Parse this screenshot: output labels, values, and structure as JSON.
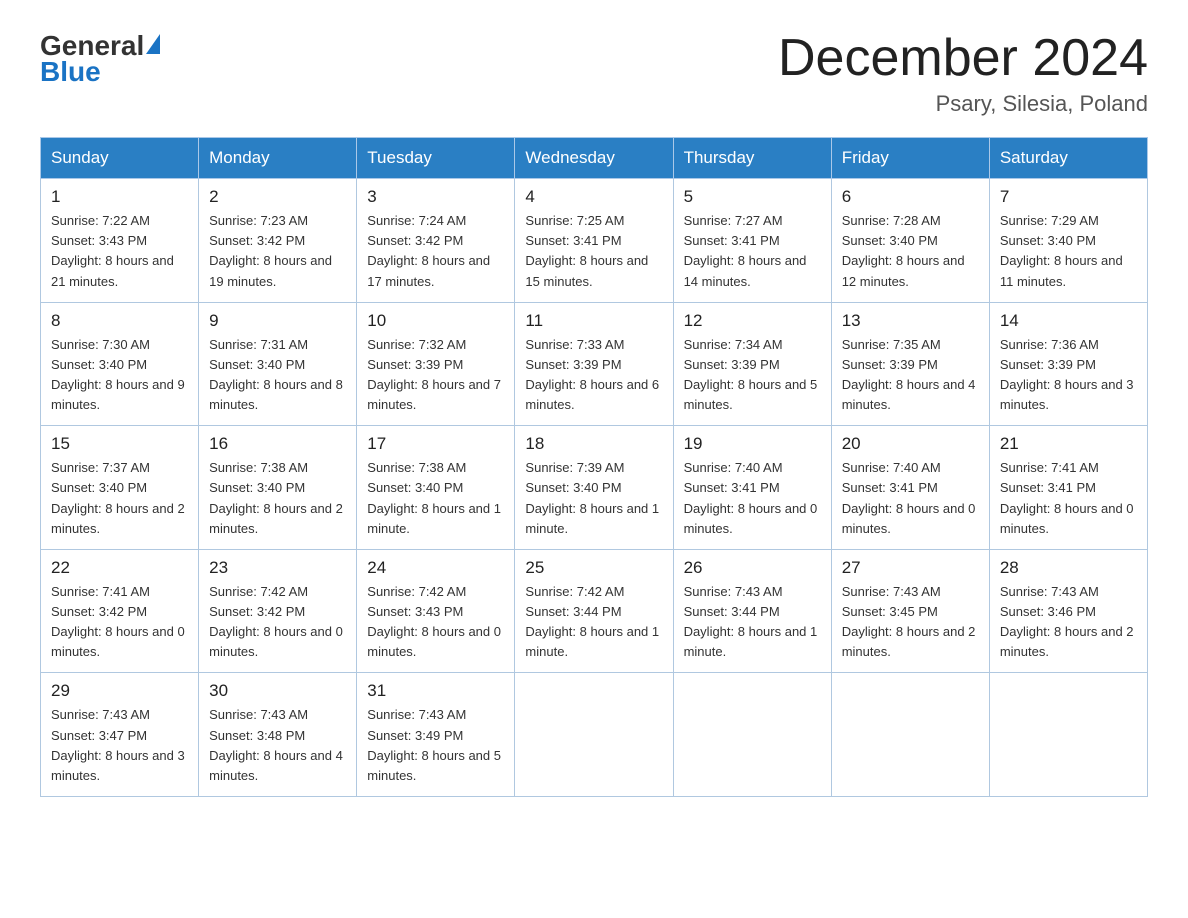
{
  "header": {
    "logo_general": "General",
    "logo_blue": "Blue",
    "main_title": "December 2024",
    "subtitle": "Psary, Silesia, Poland"
  },
  "days_of_week": [
    "Sunday",
    "Monday",
    "Tuesday",
    "Wednesday",
    "Thursday",
    "Friday",
    "Saturday"
  ],
  "weeks": [
    [
      {
        "day": "1",
        "sunrise": "7:22 AM",
        "sunset": "3:43 PM",
        "daylight": "8 hours and 21 minutes."
      },
      {
        "day": "2",
        "sunrise": "7:23 AM",
        "sunset": "3:42 PM",
        "daylight": "8 hours and 19 minutes."
      },
      {
        "day": "3",
        "sunrise": "7:24 AM",
        "sunset": "3:42 PM",
        "daylight": "8 hours and 17 minutes."
      },
      {
        "day": "4",
        "sunrise": "7:25 AM",
        "sunset": "3:41 PM",
        "daylight": "8 hours and 15 minutes."
      },
      {
        "day": "5",
        "sunrise": "7:27 AM",
        "sunset": "3:41 PM",
        "daylight": "8 hours and 14 minutes."
      },
      {
        "day": "6",
        "sunrise": "7:28 AM",
        "sunset": "3:40 PM",
        "daylight": "8 hours and 12 minutes."
      },
      {
        "day": "7",
        "sunrise": "7:29 AM",
        "sunset": "3:40 PM",
        "daylight": "8 hours and 11 minutes."
      }
    ],
    [
      {
        "day": "8",
        "sunrise": "7:30 AM",
        "sunset": "3:40 PM",
        "daylight": "8 hours and 9 minutes."
      },
      {
        "day": "9",
        "sunrise": "7:31 AM",
        "sunset": "3:40 PM",
        "daylight": "8 hours and 8 minutes."
      },
      {
        "day": "10",
        "sunrise": "7:32 AM",
        "sunset": "3:39 PM",
        "daylight": "8 hours and 7 minutes."
      },
      {
        "day": "11",
        "sunrise": "7:33 AM",
        "sunset": "3:39 PM",
        "daylight": "8 hours and 6 minutes."
      },
      {
        "day": "12",
        "sunrise": "7:34 AM",
        "sunset": "3:39 PM",
        "daylight": "8 hours and 5 minutes."
      },
      {
        "day": "13",
        "sunrise": "7:35 AM",
        "sunset": "3:39 PM",
        "daylight": "8 hours and 4 minutes."
      },
      {
        "day": "14",
        "sunrise": "7:36 AM",
        "sunset": "3:39 PM",
        "daylight": "8 hours and 3 minutes."
      }
    ],
    [
      {
        "day": "15",
        "sunrise": "7:37 AM",
        "sunset": "3:40 PM",
        "daylight": "8 hours and 2 minutes."
      },
      {
        "day": "16",
        "sunrise": "7:38 AM",
        "sunset": "3:40 PM",
        "daylight": "8 hours and 2 minutes."
      },
      {
        "day": "17",
        "sunrise": "7:38 AM",
        "sunset": "3:40 PM",
        "daylight": "8 hours and 1 minute."
      },
      {
        "day": "18",
        "sunrise": "7:39 AM",
        "sunset": "3:40 PM",
        "daylight": "8 hours and 1 minute."
      },
      {
        "day": "19",
        "sunrise": "7:40 AM",
        "sunset": "3:41 PM",
        "daylight": "8 hours and 0 minutes."
      },
      {
        "day": "20",
        "sunrise": "7:40 AM",
        "sunset": "3:41 PM",
        "daylight": "8 hours and 0 minutes."
      },
      {
        "day": "21",
        "sunrise": "7:41 AM",
        "sunset": "3:41 PM",
        "daylight": "8 hours and 0 minutes."
      }
    ],
    [
      {
        "day": "22",
        "sunrise": "7:41 AM",
        "sunset": "3:42 PM",
        "daylight": "8 hours and 0 minutes."
      },
      {
        "day": "23",
        "sunrise": "7:42 AM",
        "sunset": "3:42 PM",
        "daylight": "8 hours and 0 minutes."
      },
      {
        "day": "24",
        "sunrise": "7:42 AM",
        "sunset": "3:43 PM",
        "daylight": "8 hours and 0 minutes."
      },
      {
        "day": "25",
        "sunrise": "7:42 AM",
        "sunset": "3:44 PM",
        "daylight": "8 hours and 1 minute."
      },
      {
        "day": "26",
        "sunrise": "7:43 AM",
        "sunset": "3:44 PM",
        "daylight": "8 hours and 1 minute."
      },
      {
        "day": "27",
        "sunrise": "7:43 AM",
        "sunset": "3:45 PM",
        "daylight": "8 hours and 2 minutes."
      },
      {
        "day": "28",
        "sunrise": "7:43 AM",
        "sunset": "3:46 PM",
        "daylight": "8 hours and 2 minutes."
      }
    ],
    [
      {
        "day": "29",
        "sunrise": "7:43 AM",
        "sunset": "3:47 PM",
        "daylight": "8 hours and 3 minutes."
      },
      {
        "day": "30",
        "sunrise": "7:43 AM",
        "sunset": "3:48 PM",
        "daylight": "8 hours and 4 minutes."
      },
      {
        "day": "31",
        "sunrise": "7:43 AM",
        "sunset": "3:49 PM",
        "daylight": "8 hours and 5 minutes."
      },
      null,
      null,
      null,
      null
    ]
  ]
}
